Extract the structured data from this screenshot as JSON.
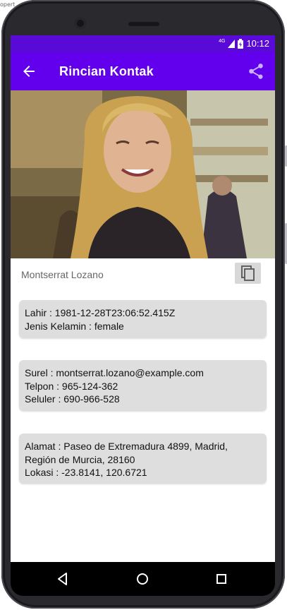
{
  "window": {
    "corner_label": "opert"
  },
  "status_bar": {
    "network": "4G",
    "time": "10:12"
  },
  "app_bar": {
    "title": "Rincian Kontak",
    "back_icon": "arrow-back-icon",
    "share_icon": "share-icon",
    "background": "#6200ee"
  },
  "contact": {
    "name": "Montserrat Lozano",
    "copy_icon": "copy-icon",
    "personal": {
      "birth": "Lahir : 1981-12-28T23:06:52.415Z",
      "gender": "Jenis Kelamin : female"
    },
    "contacts": {
      "email": "Surel : montserrat.lozano@example.com",
      "phone": "Telpon : 965-124-362",
      "cell": "Seluler : 690-966-528"
    },
    "location": {
      "address": "Alamat : Paseo de Extremadura 4899, Madrid, Región de Murcia, 28160",
      "coordinates": "Lokasi : -23.8141, 120.6721"
    }
  },
  "nav_bar": {
    "back_icon": "nav-back-icon",
    "home_icon": "nav-home-icon",
    "recents_icon": "nav-recents-icon"
  },
  "colors": {
    "status_bar": "#5a0ad6",
    "app_bar": "#6200ee",
    "card": "#dedede"
  }
}
